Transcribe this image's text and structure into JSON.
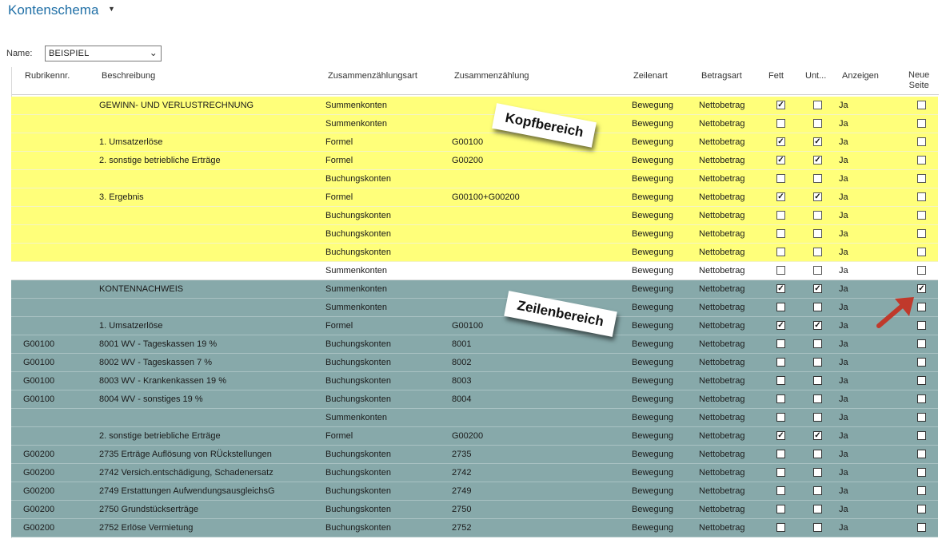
{
  "page": {
    "title": "Kontenschema",
    "name_label": "Name:",
    "name_value": "BEISPIEL"
  },
  "columns": {
    "rubrik": "Rubrikennr.",
    "beschreibung": "Beschreibung",
    "zus_art": "Zusammenzählungsart",
    "zusammen": "Zusammenzählung",
    "zeilenart": "Zeilenart",
    "betragsart": "Betragsart",
    "fett": "Fett",
    "unt": "Unt...",
    "anzeigen": "Anzeigen",
    "neue_seite_1": "Neue",
    "neue_seite_2": "Seite"
  },
  "annotations": {
    "kopf": "Kopfbereich",
    "zeilen": "Zeilenbereich"
  },
  "icons": {
    "title_dropdown": "caret-down-icon",
    "select_dropdown": "chevron-down-icon",
    "pointer": "red-arrow-icon"
  },
  "colors": {
    "title": "#1f6fa6",
    "kopf_band": "#ffff7a",
    "zeilen_band": "#87a9aa",
    "arrow": "#c0392b"
  },
  "rows": [
    {
      "band": "yellow",
      "rubrik": "",
      "beschreibung": "GEWINN- UND VERLUSTRECHNUNG",
      "zus_art": "Summenkonten",
      "zusammen": "",
      "zeilenart": "Bewegung",
      "betragsart": "Nettobetrag",
      "fett": true,
      "unt": false,
      "anzeigen": "Ja",
      "neue_seite": false
    },
    {
      "band": "yellow",
      "rubrik": "",
      "beschreibung": "",
      "zus_art": "Summenkonten",
      "zusammen": "",
      "zeilenart": "Bewegung",
      "betragsart": "Nettobetrag",
      "fett": false,
      "unt": false,
      "anzeigen": "Ja",
      "neue_seite": false
    },
    {
      "band": "yellow",
      "rubrik": "",
      "beschreibung": "1. Umsatzerlöse",
      "zus_art": "Formel",
      "zusammen": "G00100",
      "zeilenart": "Bewegung",
      "betragsart": "Nettobetrag",
      "fett": true,
      "unt": true,
      "anzeigen": "Ja",
      "neue_seite": false
    },
    {
      "band": "yellow",
      "rubrik": "",
      "beschreibung": "2. sonstige betriebliche Erträge",
      "zus_art": "Formel",
      "zusammen": "G00200",
      "zeilenart": "Bewegung",
      "betragsart": "Nettobetrag",
      "fett": true,
      "unt": true,
      "anzeigen": "Ja",
      "neue_seite": false
    },
    {
      "band": "yellow",
      "rubrik": "",
      "beschreibung": "",
      "zus_art": "Buchungskonten",
      "zusammen": "",
      "zeilenart": "Bewegung",
      "betragsart": "Nettobetrag",
      "fett": false,
      "unt": false,
      "anzeigen": "Ja",
      "neue_seite": false
    },
    {
      "band": "yellow",
      "rubrik": "",
      "beschreibung": "3. Ergebnis",
      "zus_art": "Formel",
      "zusammen": "G00100+G00200",
      "zeilenart": "Bewegung",
      "betragsart": "Nettobetrag",
      "fett": true,
      "unt": true,
      "anzeigen": "Ja",
      "neue_seite": false
    },
    {
      "band": "yellow",
      "rubrik": "",
      "beschreibung": "",
      "zus_art": "Buchungskonten",
      "zusammen": "",
      "zeilenart": "Bewegung",
      "betragsart": "Nettobetrag",
      "fett": false,
      "unt": false,
      "anzeigen": "Ja",
      "neue_seite": false
    },
    {
      "band": "yellow",
      "rubrik": "",
      "beschreibung": "",
      "zus_art": "Buchungskonten",
      "zusammen": "",
      "zeilenart": "Bewegung",
      "betragsart": "Nettobetrag",
      "fett": false,
      "unt": false,
      "anzeigen": "Ja",
      "neue_seite": false
    },
    {
      "band": "yellow",
      "rubrik": "",
      "beschreibung": "",
      "zus_art": "Buchungskonten",
      "zusammen": "",
      "zeilenart": "Bewegung",
      "betragsart": "Nettobetrag",
      "fett": false,
      "unt": false,
      "anzeigen": "Ja",
      "neue_seite": false
    },
    {
      "band": "white",
      "rubrik": "",
      "beschreibung": "",
      "zus_art": "Summenkonten",
      "zusammen": "",
      "zeilenart": "Bewegung",
      "betragsart": "Nettobetrag",
      "fett": false,
      "unt": false,
      "anzeigen": "Ja",
      "neue_seite": false
    },
    {
      "band": "teal",
      "rubrik": "",
      "beschreibung": "KONTENNACHWEIS",
      "zus_art": "Summenkonten",
      "zusammen": "",
      "zeilenart": "Bewegung",
      "betragsart": "Nettobetrag",
      "fett": true,
      "unt": true,
      "anzeigen": "Ja",
      "neue_seite": true
    },
    {
      "band": "teal",
      "rubrik": "",
      "beschreibung": "",
      "zus_art": "Summenkonten",
      "zusammen": "",
      "zeilenart": "Bewegung",
      "betragsart": "Nettobetrag",
      "fett": false,
      "unt": false,
      "anzeigen": "Ja",
      "neue_seite": false
    },
    {
      "band": "teal",
      "rubrik": "",
      "beschreibung": "1. Umsatzerlöse",
      "zus_art": "Formel",
      "zusammen": "G00100",
      "zeilenart": "Bewegung",
      "betragsart": "Nettobetrag",
      "fett": true,
      "unt": true,
      "anzeigen": "Ja",
      "neue_seite": false
    },
    {
      "band": "teal",
      "rubrik": "G00100",
      "beschreibung": "8001 WV - Tageskassen 19 %",
      "zus_art": "Buchungskonten",
      "zusammen": "8001",
      "zeilenart": "Bewegung",
      "betragsart": "Nettobetrag",
      "fett": false,
      "unt": false,
      "anzeigen": "Ja",
      "neue_seite": false
    },
    {
      "band": "teal",
      "rubrik": "G00100",
      "beschreibung": "8002 WV - Tageskassen 7 %",
      "zus_art": "Buchungskonten",
      "zusammen": "8002",
      "zeilenart": "Bewegung",
      "betragsart": "Nettobetrag",
      "fett": false,
      "unt": false,
      "anzeigen": "Ja",
      "neue_seite": false
    },
    {
      "band": "teal",
      "rubrik": "G00100",
      "beschreibung": "8003 WV - Krankenkassen 19 %",
      "zus_art": "Buchungskonten",
      "zusammen": "8003",
      "zeilenart": "Bewegung",
      "betragsart": "Nettobetrag",
      "fett": false,
      "unt": false,
      "anzeigen": "Ja",
      "neue_seite": false
    },
    {
      "band": "teal",
      "rubrik": "G00100",
      "beschreibung": "8004 WV - sonstiges 19 %",
      "zus_art": "Buchungskonten",
      "zusammen": "8004",
      "zeilenart": "Bewegung",
      "betragsart": "Nettobetrag",
      "fett": false,
      "unt": false,
      "anzeigen": "Ja",
      "neue_seite": false
    },
    {
      "band": "teal",
      "rubrik": "",
      "beschreibung": "",
      "zus_art": "Summenkonten",
      "zusammen": "",
      "zeilenart": "Bewegung",
      "betragsart": "Nettobetrag",
      "fett": false,
      "unt": false,
      "anzeigen": "Ja",
      "neue_seite": false
    },
    {
      "band": "teal",
      "rubrik": "",
      "beschreibung": "2. sonstige betriebliche Erträge",
      "zus_art": "Formel",
      "zusammen": "G00200",
      "zeilenart": "Bewegung",
      "betragsart": "Nettobetrag",
      "fett": true,
      "unt": true,
      "anzeigen": "Ja",
      "neue_seite": false
    },
    {
      "band": "teal",
      "rubrik": "G00200",
      "beschreibung": "2735 Erträge Auflösung von RÜckstellungen",
      "zus_art": "Buchungskonten",
      "zusammen": "2735",
      "zeilenart": "Bewegung",
      "betragsart": "Nettobetrag",
      "fett": false,
      "unt": false,
      "anzeigen": "Ja",
      "neue_seite": false
    },
    {
      "band": "teal",
      "rubrik": "G00200",
      "beschreibung": "2742 Versich.entschädigung, Schadenersatz",
      "zus_art": "Buchungskonten",
      "zusammen": "2742",
      "zeilenart": "Bewegung",
      "betragsart": "Nettobetrag",
      "fett": false,
      "unt": false,
      "anzeigen": "Ja",
      "neue_seite": false
    },
    {
      "band": "teal",
      "rubrik": "G00200",
      "beschreibung": "2749 Erstattungen AufwendungsausgleichsG",
      "zus_art": "Buchungskonten",
      "zusammen": "2749",
      "zeilenart": "Bewegung",
      "betragsart": "Nettobetrag",
      "fett": false,
      "unt": false,
      "anzeigen": "Ja",
      "neue_seite": false
    },
    {
      "band": "teal",
      "rubrik": "G00200",
      "beschreibung": "2750 Grundstückserträge",
      "zus_art": "Buchungskonten",
      "zusammen": "2750",
      "zeilenart": "Bewegung",
      "betragsart": "Nettobetrag",
      "fett": false,
      "unt": false,
      "anzeigen": "Ja",
      "neue_seite": false
    },
    {
      "band": "teal",
      "rubrik": "G00200",
      "beschreibung": "2752 Erlöse Vermietung",
      "zus_art": "Buchungskonten",
      "zusammen": "2752",
      "zeilenart": "Bewegung",
      "betragsart": "Nettobetrag",
      "fett": false,
      "unt": false,
      "anzeigen": "Ja",
      "neue_seite": false
    }
  ]
}
